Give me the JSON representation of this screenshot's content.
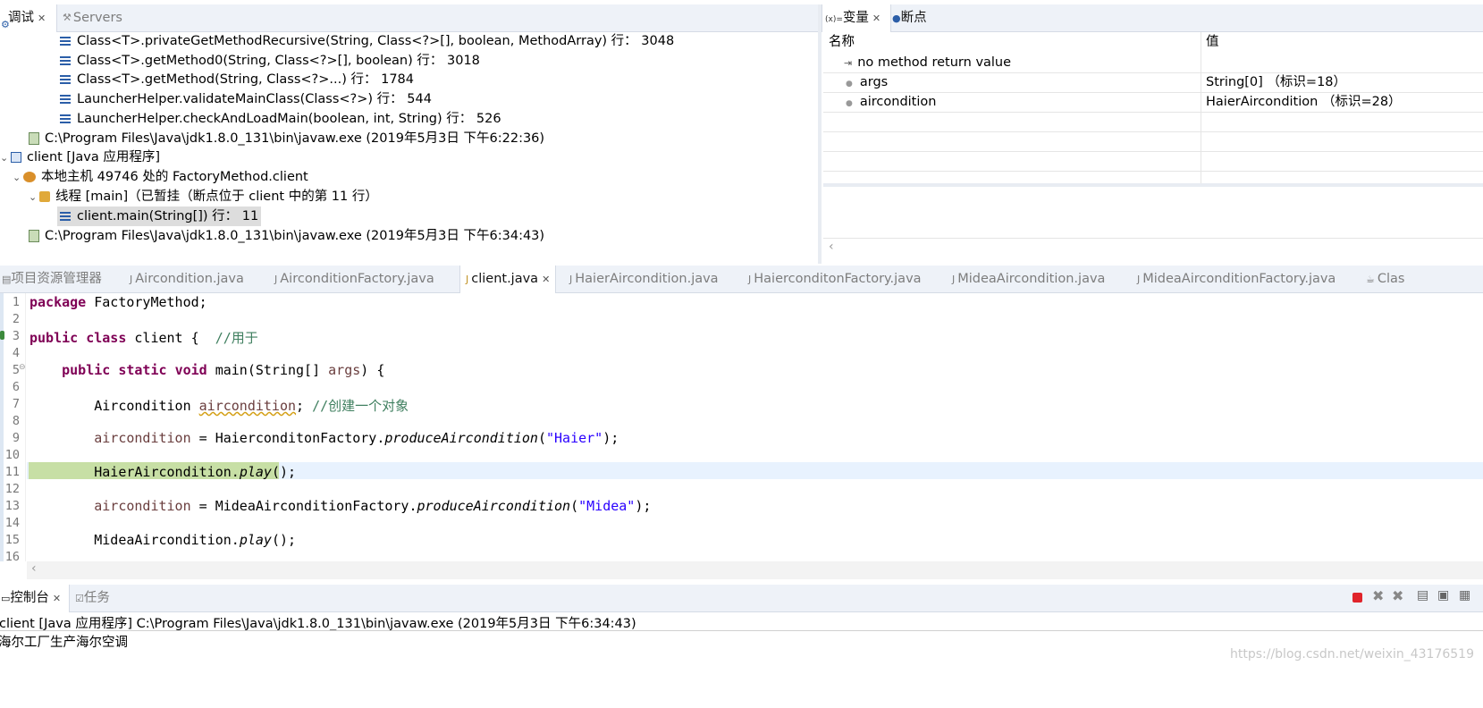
{
  "debug_panel": {
    "tabs": [
      {
        "label": "调试",
        "active": true
      },
      {
        "label": "Servers",
        "active": false
      }
    ],
    "stack_frames_top": [
      "Class<T>.privateGetMethodRecursive(String, Class<?>[], boolean, MethodArray) 行： 3048",
      "Class<T>.getMethod0(String, Class<?>[], boolean) 行： 3018",
      "Class<T>.getMethod(String, Class<?>...) 行： 1784",
      "LauncherHelper.validateMainClass(Class<?>) 行： 544",
      "LauncherHelper.checkAndLoadMain(boolean, int, String) 行： 526"
    ],
    "process_1": "C:\\Program Files\\Java\\jdk1.8.0_131\\bin\\javaw.exe  (2019年5月3日 下午6:22:36)",
    "launch": "client [Java 应用程序]",
    "vm": "本地主机 49746 处的 FactoryMethod.client",
    "thread": "线程 [main]（已暂挂（断点位于 client 中的第 11 行）",
    "selected_frame": "client.main(String[]) 行： 11",
    "process_2": "C:\\Program Files\\Java\\jdk1.8.0_131\\bin\\javaw.exe  (2019年5月3日 下午6:34:43)"
  },
  "variables_panel": {
    "tabs": [
      {
        "label": "变量",
        "active": true
      },
      {
        "label": "断点",
        "active": false
      }
    ],
    "col_name": "名称",
    "col_value": "值",
    "rows": [
      {
        "name": "no method return value",
        "value": ""
      },
      {
        "name": "args",
        "value": "String[0]  （标识=18）"
      },
      {
        "name": "aircondition",
        "value": "HaierAircondition  （标识=28）"
      }
    ]
  },
  "editor": {
    "tabs": [
      {
        "label": "项目资源管理器",
        "active": false
      },
      {
        "label": "Aircondition.java",
        "active": false
      },
      {
        "label": "AirconditionFactory.java",
        "active": false
      },
      {
        "label": "client.java",
        "active": true
      },
      {
        "label": "HaierAircondition.java",
        "active": false
      },
      {
        "label": "HaierconditonFactory.java",
        "active": false
      },
      {
        "label": "MideaAircondition.java",
        "active": false
      },
      {
        "label": "MideaAirconditionFactory.java",
        "active": false
      },
      {
        "label": "Clas",
        "active": false
      }
    ],
    "line_numbers": [
      "1",
      "2",
      "3",
      "4",
      "5",
      "6",
      "7",
      "8",
      "9",
      "10",
      "11",
      "12",
      "13",
      "14",
      "15",
      "16"
    ],
    "code": {
      "l1_kw": "package",
      "l1_rest": " FactoryMethod;",
      "l3_kw1": "public",
      "l3_kw2": "class",
      "l3_rest": " client {  ",
      "l3_comment": "//用于",
      "l5_kw1": "public",
      "l5_kw2": "static",
      "l5_kw3": "void",
      "l5_rest": " main(String[] ",
      "l5_param": "args",
      "l5_end": ") {",
      "l7_type": "Aircondition ",
      "l7_var": "aircondition",
      "l7_semi": "; ",
      "l7_comment": "//创建一个对象",
      "l9_var": "aircondition",
      "l9_mid": " = HaierconditonFactory.",
      "l9_method": "produceAircondition",
      "l9_open": "(",
      "l9_str": "\"Haier\"",
      "l9_close": ");",
      "l11_cls": "HaierAircondition.",
      "l11_method": "play",
      "l11_end": "();",
      "l13_var": "aircondition",
      "l13_mid": " = MideaAirconditionFactory.",
      "l13_method": "produceAircondition",
      "l13_open": "(",
      "l13_str": "\"Midea\"",
      "l13_close": ");",
      "l15_cls": "MideaAircondition.",
      "l15_method": "play",
      "l15_end": "();"
    }
  },
  "console_panel": {
    "tabs": [
      {
        "label": "控制台",
        "active": true
      },
      {
        "label": "任务",
        "active": false
      }
    ],
    "header": "client [Java 应用程序] C:\\Program Files\\Java\\jdk1.8.0_131\\bin\\javaw.exe  (2019年5月3日 下午6:34:43)",
    "output": "海尔工厂生产海尔空调"
  },
  "watermark": "https://blog.csdn.net/weixin_43176519",
  "icons": [
    "debug-icon",
    "servers-icon",
    "stack-frame-icon",
    "process-icon",
    "launch-icon",
    "thread-icon",
    "variables-icon",
    "breakpoints-icon",
    "java-file-icon",
    "terminate-icon",
    "remove-launch-icon",
    "remove-all-icon",
    "pin-console-icon",
    "display-console-icon"
  ],
  "colors": {
    "accent": "#2b5ea8",
    "tab_bar": "#eef2f8",
    "current_line": "#c7dfa5",
    "keyword": "#7f0055",
    "comment": "#3f7f5f",
    "field": "#0000c0",
    "string": "#2a00ff",
    "terminate": "#e0242b"
  }
}
